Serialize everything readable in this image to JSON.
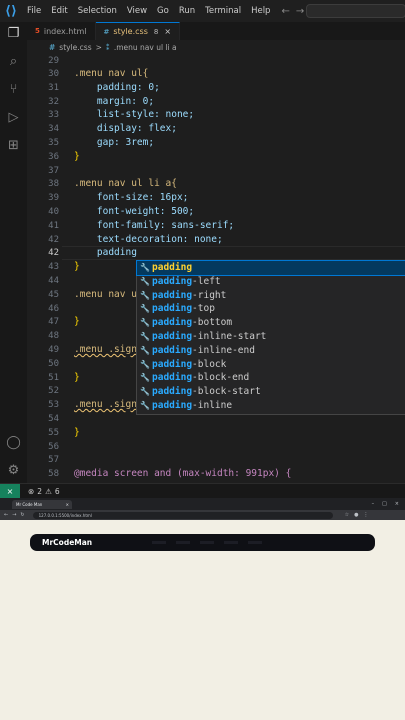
{
  "menubar": {
    "items": [
      "File",
      "Edit",
      "Selection",
      "View",
      "Go",
      "Run",
      "Terminal",
      "Help"
    ]
  },
  "tabs": [
    {
      "file_icon": "5",
      "label": "index.html",
      "active": false
    },
    {
      "file_icon": "#",
      "label": "style.css",
      "modified": "8",
      "active": true
    }
  ],
  "breadcrumb": {
    "file": "style.css",
    "sep": ">",
    "symbol": ".menu nav ul li a"
  },
  "editor": {
    "current_line": "42",
    "lines": [
      {
        "n": "29",
        "text": ""
      },
      {
        "n": "30",
        "text": ".menu nav ul{"
      },
      {
        "n": "31",
        "text": "    padding: 0;"
      },
      {
        "n": "32",
        "text": "    margin: 0;"
      },
      {
        "n": "33",
        "text": "    list-style: none;"
      },
      {
        "n": "34",
        "text": "    display: flex;"
      },
      {
        "n": "35",
        "text": "    gap: 3rem;"
      },
      {
        "n": "36",
        "text": "}"
      },
      {
        "n": "37",
        "text": ""
      },
      {
        "n": "38",
        "text": ".menu nav ul li a{"
      },
      {
        "n": "39",
        "text": "    font-size: 16px;"
      },
      {
        "n": "40",
        "text": "    font-weight: 500;"
      },
      {
        "n": "41",
        "text": "    font-family: sans-serif;"
      },
      {
        "n": "42",
        "text": "    text-decoration: none;"
      },
      {
        "n": "42",
        "text": "    padding"
      },
      {
        "n": "43",
        "text": "}"
      },
      {
        "n": "44",
        "text": ""
      },
      {
        "n": "45",
        "text": ".menu nav u"
      },
      {
        "n": "46",
        "text": ""
      },
      {
        "n": "47",
        "text": "}"
      },
      {
        "n": "48",
        "text": ""
      },
      {
        "n": "49",
        "text": ".menu .sign"
      },
      {
        "n": "50",
        "text": ""
      },
      {
        "n": "51",
        "text": "}"
      },
      {
        "n": "52",
        "text": ""
      },
      {
        "n": "53",
        "text": ".menu .sign"
      },
      {
        "n": "54",
        "text": ""
      },
      {
        "n": "55",
        "text": "}"
      },
      {
        "n": "56",
        "text": ""
      },
      {
        "n": "57",
        "text": ""
      },
      {
        "n": "58",
        "text": "@media screen and (max-width: 991px) {"
      }
    ]
  },
  "suggestions": {
    "typed": "padding",
    "items": [
      "padding",
      "padding-left",
      "padding-right",
      "padding-top",
      "padding-bottom",
      "padding-inline-start",
      "padding-inline-end",
      "padding-block",
      "padding-block-end",
      "padding-block-start",
      "padding-inline"
    ]
  },
  "statusbar": {
    "errors": "2",
    "warnings": "6"
  },
  "browser": {
    "tab_title": "Mr Code Man",
    "url": "127.0.0.1:5500/index.html",
    "brand": "MrCodeMan"
  },
  "colors": {
    "editor_bg": "#1e1e1e",
    "selector": "#d7ba7d",
    "property": "#9cdcfe",
    "value": "#ce9178",
    "accent": "#0078d4",
    "page_bg": "#f2efe4",
    "page_nav_bg": "#0f1015"
  }
}
